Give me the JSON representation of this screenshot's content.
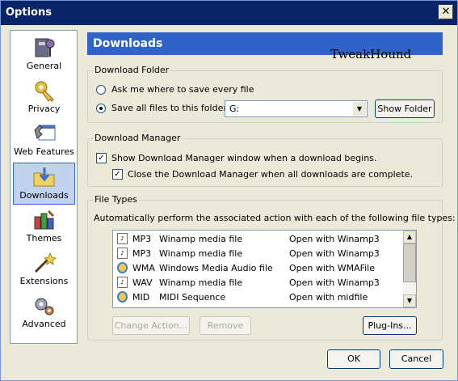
{
  "window": {
    "title": "Options",
    "close_label": "✕"
  },
  "sidebar": {
    "items": [
      {
        "label": "General"
      },
      {
        "label": "Privacy"
      },
      {
        "label": "Web Features"
      },
      {
        "label": "Downloads"
      },
      {
        "label": "Themes"
      },
      {
        "label": "Extensions"
      },
      {
        "label": "Advanced"
      }
    ],
    "selected": "Downloads"
  },
  "header": {
    "title": "Downloads",
    "watermark": "TweakHound"
  },
  "download_folder": {
    "group_label": "Download Folder",
    "ask_label": "Ask me where to save every file",
    "save_label": "Save all files to this folder:",
    "folder_value": "G:",
    "show_folder_label": "Show Folder"
  },
  "download_manager": {
    "group_label": "Download Manager",
    "show_label": "Show Download Manager window when a download begins.",
    "close_label": "Close the Download Manager when all downloads are complete."
  },
  "file_types": {
    "group_label": "File Types",
    "description": "Automatically perform the associated action with each of the following file types:",
    "rows": [
      {
        "ext": "MP3",
        "desc": "Winamp media file",
        "action": "Open with Winamp3",
        "icon": "winamp-file-icon"
      },
      {
        "ext": "MP3",
        "desc": "Winamp media file",
        "action": "Open with Winamp3",
        "icon": "winamp-file-icon"
      },
      {
        "ext": "WMA",
        "desc": "Windows Media Audio file",
        "action": "Open with WMAFile",
        "icon": "wma-file-icon"
      },
      {
        "ext": "WAV",
        "desc": "Winamp media file",
        "action": "Open with Winamp3",
        "icon": "winamp-file-icon"
      },
      {
        "ext": "MID",
        "desc": "MIDI Sequence",
        "action": "Open with midfile",
        "icon": "wma-file-icon"
      }
    ],
    "change_action_label": "Change Action...",
    "remove_label": "Remove",
    "plugins_label": "Plug-Ins..."
  },
  "footer": {
    "ok_label": "OK",
    "cancel_label": "Cancel"
  },
  "colors": {
    "title_bar": "#0A246A",
    "header": "#2F63C8",
    "selection": "#C1D2EE"
  }
}
